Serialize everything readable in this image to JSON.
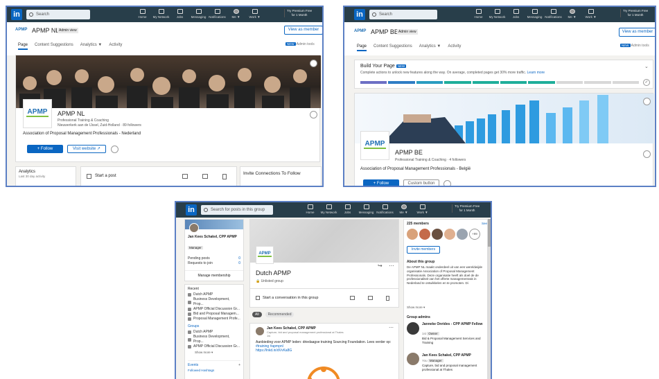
{
  "nav": {
    "items": [
      {
        "label": "Home",
        "icon": "home-icon"
      },
      {
        "label": "My Network",
        "icon": "network-icon"
      },
      {
        "label": "Jobs",
        "icon": "jobs-icon"
      },
      {
        "label": "Messaging",
        "icon": "messaging-icon"
      },
      {
        "label": "Notifications",
        "icon": "bell-icon"
      },
      {
        "label": "Me ▼",
        "icon": "avatar"
      },
      {
        "label": "Work ▼",
        "icon": "grid-icon"
      }
    ],
    "premium_line1": "Try Premium Free",
    "premium_line2": "for 1 Month",
    "logo": "in"
  },
  "nl": {
    "search_placeholder": "Search",
    "page_name": "APMP NL",
    "admin_badge": "Admin view",
    "view_as_member": "View as member",
    "tabs": [
      "Page",
      "Content Suggestions",
      "Analytics ▼",
      "Activity"
    ],
    "admin_tools": "Admin tools",
    "new_badge": "NEW",
    "company_name": "APMP NL",
    "industry": "Professional Training & Coaching",
    "location": "Nieuwerkerk aan de IJssel, Zuid-Holland · 89 followers",
    "tagline": "Association of Proposal Management Professionals - Nederland",
    "follow": "+ Follow",
    "visit": "Visit website ↗",
    "analytics_title": "Analytics",
    "analytics_sub": "Last 30 day activity",
    "start_post": "Start a post",
    "invite": "Invite Connections To Follow",
    "logo_text": "APMP"
  },
  "be": {
    "search_placeholder": "Search",
    "page_name": "APMP BE",
    "admin_badge": "Admin view",
    "view_as_member": "View as member",
    "tabs": [
      "Page",
      "Content Suggestions",
      "Analytics ▼",
      "Activity"
    ],
    "admin_tools": "Admin tools",
    "new_badge": "NEW",
    "build_title": "Build Your Page",
    "build_desc": "Complete actions to unlock new features along the way. On average, completed pages get 30% more traffic.",
    "learn_more": "Learn more",
    "company_name": "APMP BE",
    "industry": "Professional Training & Coaching · 4 followers",
    "tagline": "Association of Proposal Management Professionals - België",
    "follow": "+ Follow",
    "custom_button": "Custom button",
    "logo_text": "APMP"
  },
  "group": {
    "search_placeholder": "Search for posts in this group",
    "user_name": "Jan Kees Schakel, CPP APMP",
    "manager_badge": "Manager",
    "pending": "Pending posts",
    "pending_count": "0",
    "requests": "Requests to join",
    "requests_count": "0",
    "manage": "Manage membership",
    "recent_title": "Recent",
    "recent": [
      "Dutch APMP",
      "Business Development, Prop...",
      "APMP Official Discussion Gr...",
      "Bid and Proposal Managem...",
      "Proposal Management Profe..."
    ],
    "groups_title": "Groups",
    "groups": [
      "Dutch APMP",
      "Business Development, Prop...",
      "APMP Official Discussion Gr..."
    ],
    "show_more": "Show more ▾",
    "events": "Events",
    "events_plus": "+",
    "followed_hashtags": "Followed Hashtags",
    "group_name": "Dutch APMP",
    "unlisted": "Unlisted group",
    "start_conv": "Start a conversation in this group",
    "filter_all": "All",
    "filter_rec": "Recommended",
    "post_author": "Jan Kees Schakel, CPP APMP",
    "post_headline": "Capture, bid and proposal management professional at Thales",
    "post_time": "1w",
    "post_text": "Aanbieding voor APMP leden: driedaagse training Sourcing Foundation. Lees verder op:",
    "post_tag": "#training #apmpnl",
    "post_link": "https://lnkd.in/dVvKa8G",
    "members_count": "225 members",
    "see_all": "See",
    "more_members": "+99",
    "invite_members": "Invite members",
    "about_title": "About this group",
    "about_text": "De APMP NL maakt onderdeel uit van een wereldwijde organisatie Association of Proposal Management Professionals. Deze organisatie heeft als doel de de professionaliteit van het offerte managementvak in Nederland te ontwikkelen en te promoten. Di",
    "show_more2": "Show more ▾",
    "admins_title": "Group admins",
    "admin1_name": "Janneke Onrides - CPP APMP Fellow",
    "admin1_role_prefix": "1st",
    "admin1_role": "Owner",
    "admin1_desc": "Bid & Proposal Management Services and Training",
    "admin2_name": "Jan Kees Schakel, CPP APMP",
    "admin2_role_prefix": "You",
    "admin2_role": "Manager",
    "admin2_desc": "Capture, bid and proposal management professional at Thales",
    "logo_text": "APMP"
  }
}
